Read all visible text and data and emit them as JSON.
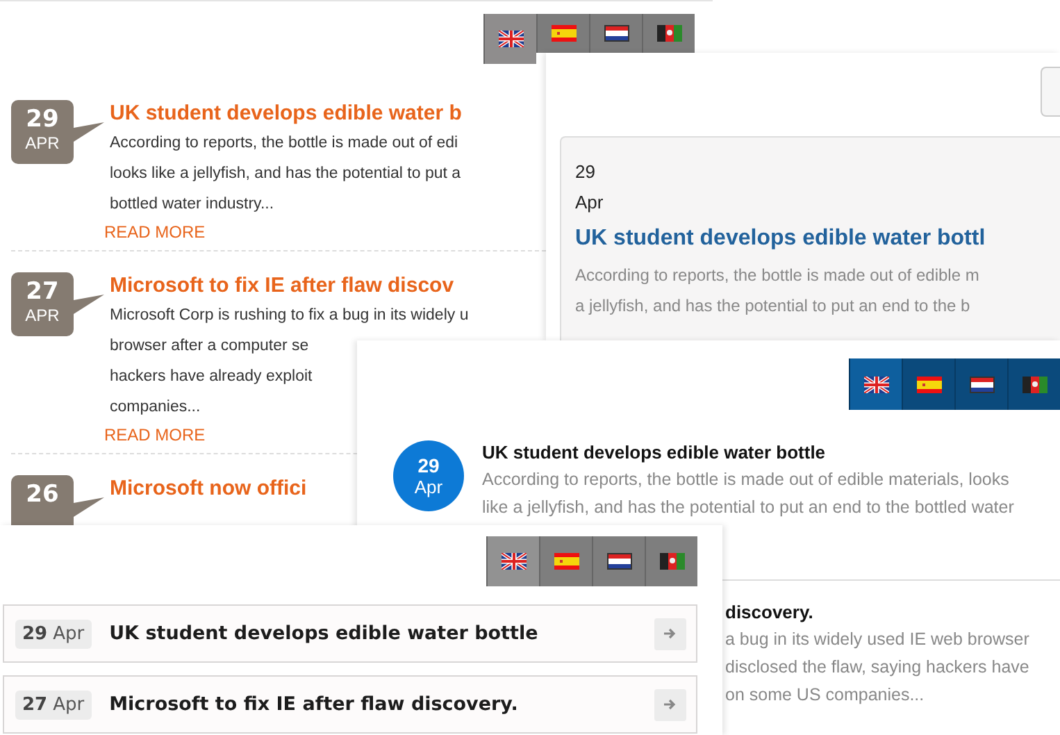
{
  "panels": [
    {
      "kind": "orange",
      "languages": [
        {
          "selected": true
        },
        {
          "selected": false
        },
        {
          "selected": false
        },
        {
          "selected": false
        }
      ],
      "articles": [
        {
          "day": "29",
          "month": "APR",
          "title": "UK student develops edible water b",
          "lines": [
            "According to reports, the bottle is made out of edi",
            "looks like a jellyfish, and has the potential to put a",
            "bottled water industry..."
          ],
          "link": "READ MORE"
        },
        {
          "day": "27",
          "month": "APR",
          "title": "Microsoft to fix IE after flaw discov",
          "lines": [
            "Microsoft Corp is rushing to fix a bug in its widely u",
            "browser after a computer se",
            "hackers have already exploit",
            "companies..."
          ],
          "link": "READ MORE"
        },
        {
          "day": "26",
          "title": "Microsoft now offici"
        }
      ]
    },
    {
      "kind": "card",
      "articles": [
        {
          "day": "29",
          "month": "Apr",
          "title": "UK student develops edible water bottl",
          "lines": [
            "According to reports, the bottle is made out of edible m",
            "a jellyfish, and has the potential to put an end to the b"
          ]
        }
      ]
    },
    {
      "kind": "blue",
      "languages": [
        {
          "selected": true
        },
        {
          "selected": false
        },
        {
          "selected": false
        },
        {
          "selected": false
        }
      ],
      "articles": [
        {
          "day": "29",
          "month": "Apr",
          "title": "UK student develops edible water bottle",
          "lines": [
            "According to reports, the bottle is made out of edible materials, looks",
            "like a jellyfish, and has the potential to put an end to the bottled water"
          ]
        },
        {
          "title": "discovery.",
          "lines": [
            "a bug in its widely used IE web browser",
            "disclosed the flaw, saying hackers have",
            "on some US companies..."
          ]
        }
      ]
    },
    {
      "kind": "list",
      "languages": [
        {
          "selected": true
        },
        {
          "selected": false
        },
        {
          "selected": false
        },
        {
          "selected": false
        }
      ],
      "articles": [
        {
          "day": "29",
          "month": "Apr",
          "title": "UK student develops edible water bottle"
        },
        {
          "day": "27",
          "month": "Apr",
          "title": "Microsoft to fix IE after flaw discovery."
        }
      ]
    }
  ]
}
